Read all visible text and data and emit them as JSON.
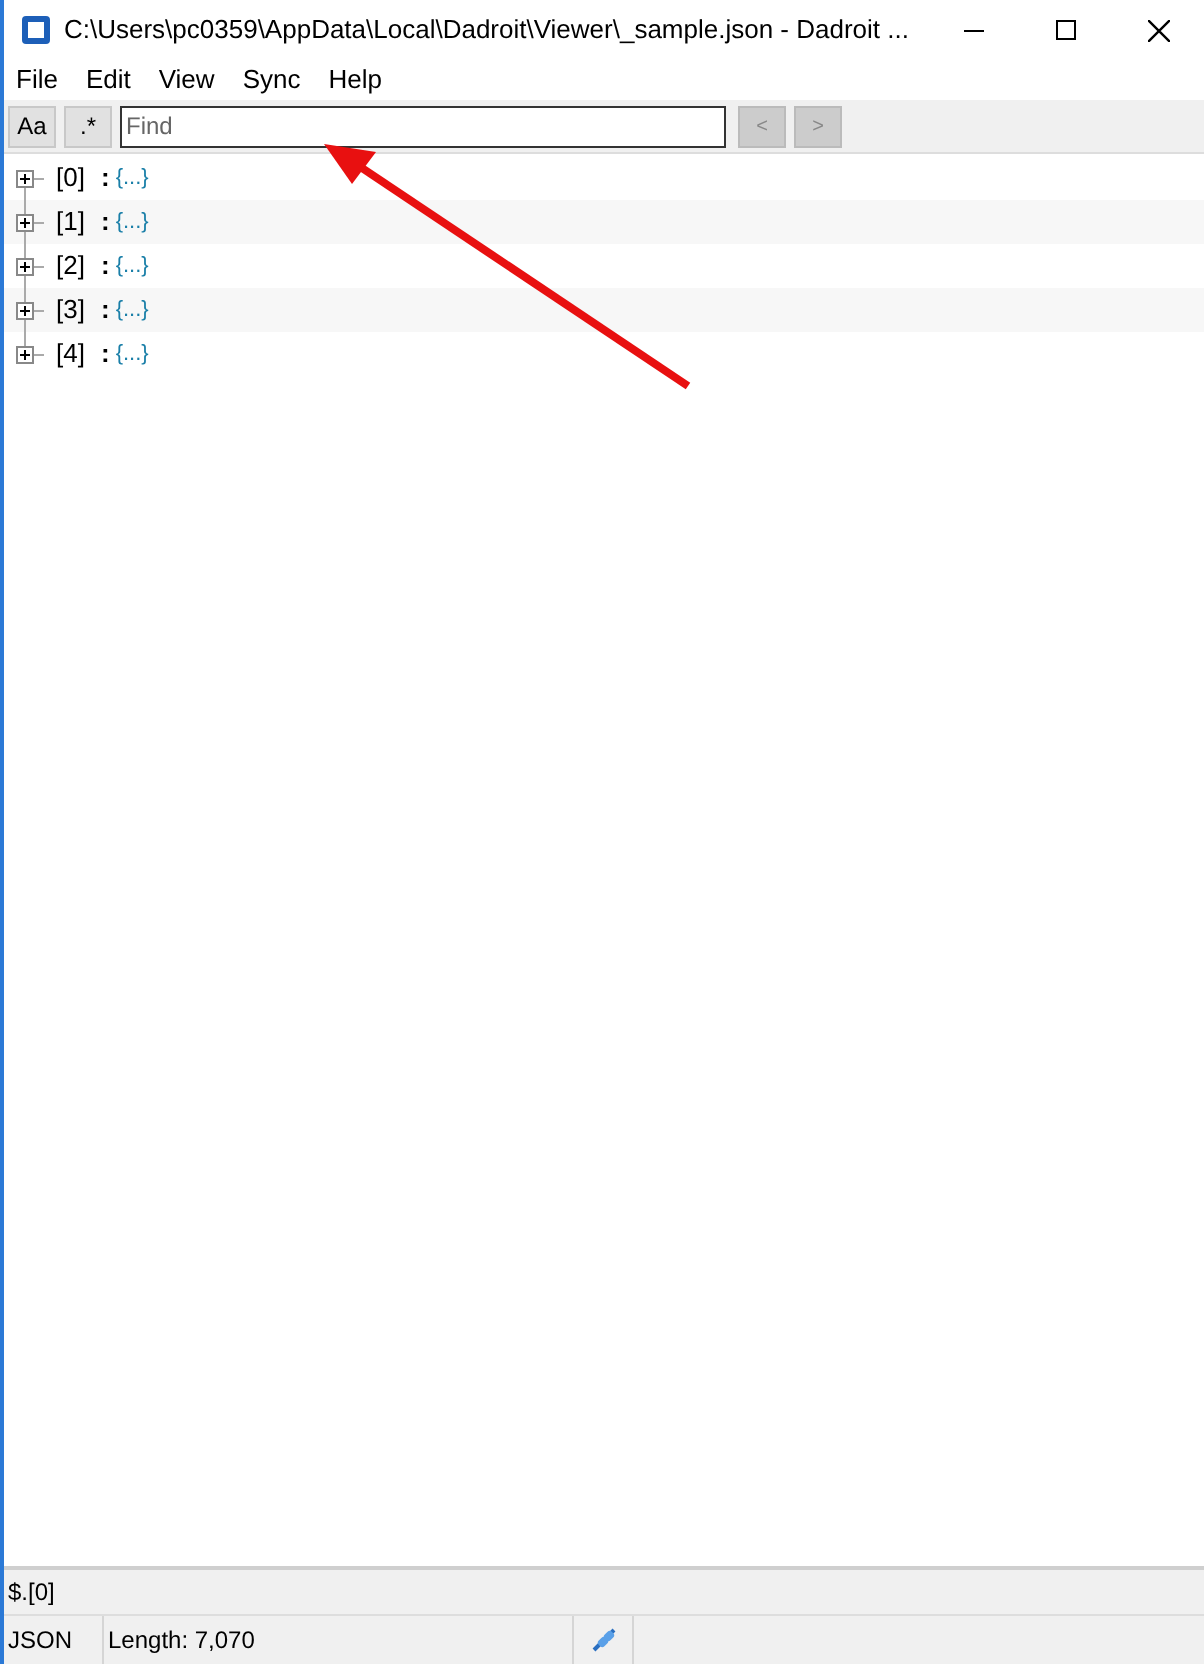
{
  "window": {
    "title": "C:\\Users\\pc0359\\AppData\\Local\\Dadroit\\Viewer\\_sample.json - Dadroit ..."
  },
  "menu": [
    "File",
    "Edit",
    "View",
    "Sync",
    "Help"
  ],
  "toolbar": {
    "case_button": "Aa",
    "regex_button": ".*",
    "search": {
      "placeholder": "Find"
    },
    "prev_button": "<",
    "next_button": ">"
  },
  "tree": [
    {
      "key": "[0]",
      "separator": ":",
      "value": "{...}",
      "expanded": false
    },
    {
      "key": "[1]",
      "separator": ":",
      "value": "{...}",
      "expanded": false
    },
    {
      "key": "[2]",
      "separator": ":",
      "value": "{...}",
      "expanded": false
    },
    {
      "key": "[3]",
      "separator": ":",
      "value": "{...}",
      "expanded": false
    },
    {
      "key": "[4]",
      "separator": ":",
      "value": "{...}",
      "expanded": false
    }
  ],
  "path_bar": "$.[0]",
  "status_bar": [
    "JSON",
    "Length: 7,070"
  ]
}
